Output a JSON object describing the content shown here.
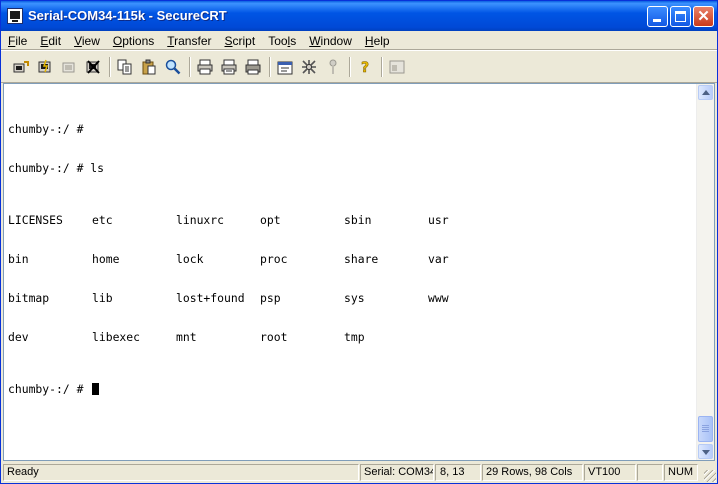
{
  "window": {
    "title": "Serial-COM34-115k - SecureCRT"
  },
  "menu": [
    {
      "accel": "F",
      "rest": "ile"
    },
    {
      "accel": "E",
      "rest": "dit"
    },
    {
      "accel": "V",
      "rest": "iew"
    },
    {
      "accel": "O",
      "rest": "ptions"
    },
    {
      "accel": "T",
      "rest": "ransfer"
    },
    {
      "accel": "S",
      "rest": "cript"
    },
    {
      "pre": "Too",
      "accel": "l",
      "rest": "s"
    },
    {
      "accel": "W",
      "rest": "indow"
    },
    {
      "accel": "H",
      "rest": "elp"
    }
  ],
  "toolbar_icons": [
    "connect-icon",
    "quick-connect-icon",
    "reconnect-icon",
    "disconnect-icon",
    "copy-icon",
    "paste-icon",
    "find-icon",
    "print-screen-icon",
    "print-selection-icon",
    "print-icon",
    "session-options-icon",
    "global-options-icon",
    "keymap-icon",
    "help-icon",
    "tile-icon"
  ],
  "terminal": {
    "lines": [
      "chumby-:/ #",
      "chumby-:/ # ls"
    ],
    "listing": [
      [
        "LICENSES",
        "etc",
        "linuxrc",
        "opt",
        "sbin",
        "usr"
      ],
      [
        "bin",
        "home",
        "lock",
        "proc",
        "share",
        "var"
      ],
      [
        "bitmap",
        "lib",
        "lost+found",
        "psp",
        "sys",
        "www"
      ],
      [
        "dev",
        "libexec",
        "mnt",
        "root",
        "tmp",
        ""
      ]
    ],
    "prompt": "chumby-:/ # "
  },
  "status": {
    "ready": "Ready",
    "connection": "Serial: COM34",
    "cursor_pos": "8, 13",
    "size": "29 Rows,  98 Cols",
    "emulation": "VT100",
    "blank": "",
    "num": "NUM"
  },
  "colors": {
    "title_bar": "#0055e5",
    "terminal_bg": "#ffffff",
    "terminal_fg": "#000000"
  }
}
